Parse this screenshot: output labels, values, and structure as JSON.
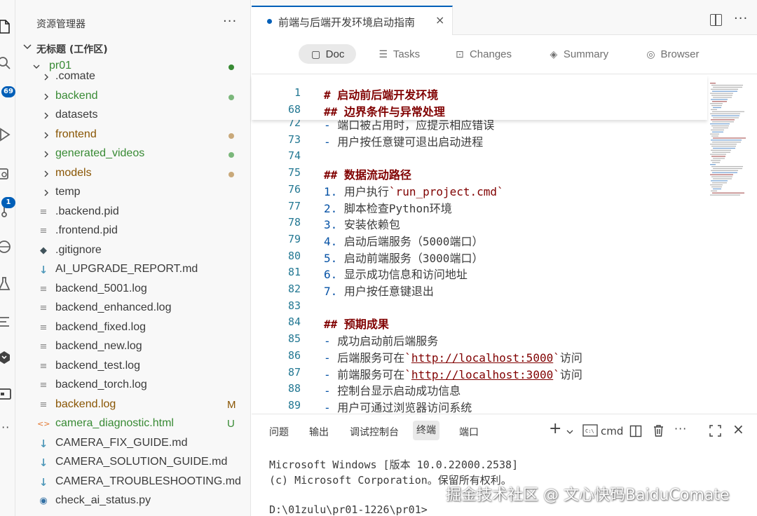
{
  "activity_bar": {
    "badges": {
      "search": "69",
      "source_control": "1"
    }
  },
  "explorer": {
    "title": "资源管理器",
    "more": "···",
    "workspace_label": "无标题 (工作区)",
    "items": [
      {
        "name": "pr01",
        "kind": "folder-open",
        "color": "#388a34",
        "dot": "#388a34"
      },
      {
        "name": ".comate",
        "kind": "folder",
        "color": "#3b3b3b"
      },
      {
        "name": "backend",
        "kind": "folder",
        "color": "#388a34",
        "dot": "#7bb77b"
      },
      {
        "name": "datasets",
        "kind": "folder",
        "color": "#3b3b3b"
      },
      {
        "name": "frontend",
        "kind": "folder",
        "color": "#895503",
        "dot": "#c9a97a"
      },
      {
        "name": "generated_videos",
        "kind": "folder",
        "color": "#388a34",
        "dot": "#7bb77b"
      },
      {
        "name": "models",
        "kind": "folder",
        "color": "#895503",
        "dot": "#c9a97a"
      },
      {
        "name": "temp",
        "kind": "folder",
        "color": "#3b3b3b"
      },
      {
        "name": ".backend.pid",
        "kind": "file",
        "color": "#3b3b3b"
      },
      {
        "name": ".frontend.pid",
        "kind": "file",
        "color": "#3b3b3b"
      },
      {
        "name": ".gitignore",
        "kind": "git",
        "color": "#3b3b3b"
      },
      {
        "name": "AI_UPGRADE_REPORT.md",
        "kind": "md",
        "color": "#3b3b3b"
      },
      {
        "name": "backend_5001.log",
        "kind": "file",
        "color": "#3b3b3b"
      },
      {
        "name": "backend_enhanced.log",
        "kind": "file",
        "color": "#3b3b3b"
      },
      {
        "name": "backend_fixed.log",
        "kind": "file",
        "color": "#3b3b3b"
      },
      {
        "name": "backend_new.log",
        "kind": "file",
        "color": "#3b3b3b"
      },
      {
        "name": "backend_test.log",
        "kind": "file",
        "color": "#3b3b3b"
      },
      {
        "name": "backend_torch.log",
        "kind": "file",
        "color": "#3b3b3b"
      },
      {
        "name": "backend.log",
        "kind": "file",
        "color": "#895503",
        "flag": "M"
      },
      {
        "name": "camera_diagnostic.html",
        "kind": "html",
        "color": "#388a34",
        "flag": "U"
      },
      {
        "name": "CAMERA_FIX_GUIDE.md",
        "kind": "md",
        "color": "#3b3b3b"
      },
      {
        "name": "CAMERA_SOLUTION_GUIDE.md",
        "kind": "md",
        "color": "#3b3b3b"
      },
      {
        "name": "CAMERA_TROUBLESHOOTING.md",
        "kind": "md",
        "color": "#3b3b3b"
      },
      {
        "name": "check_ai_status.py",
        "kind": "py",
        "color": "#3b3b3b"
      }
    ]
  },
  "editor": {
    "tab_label": "前端与后端开发环境启动指南",
    "tab_close": "×",
    "more": "···",
    "view_tabs": [
      {
        "label": "Doc",
        "icon": "doc-icon",
        "active": true
      },
      {
        "label": "Tasks",
        "icon": "tasks-icon"
      },
      {
        "label": "Changes",
        "icon": "changes-icon"
      },
      {
        "label": "Summary",
        "icon": "summary-icon"
      },
      {
        "label": "Browser",
        "icon": "browser-icon"
      }
    ],
    "sticky_lines": [
      {
        "num": "1",
        "parts": [
          {
            "t": "# 启动前后端开发环境",
            "c": "h"
          }
        ]
      },
      {
        "num": "68",
        "parts": [
          {
            "t": "## 边界条件与异常处理",
            "c": "h"
          }
        ]
      }
    ],
    "lines": [
      {
        "num": "72",
        "parts": [
          {
            "t": "- ",
            "c": "b"
          },
          {
            "t": "端口被占用时，应提示相应错误",
            "c": "tx"
          }
        ]
      },
      {
        "num": "73",
        "parts": [
          {
            "t": "- ",
            "c": "b"
          },
          {
            "t": "用户按任意键可退出启动进程",
            "c": "tx"
          }
        ]
      },
      {
        "num": "74",
        "parts": []
      },
      {
        "num": "75",
        "parts": [
          {
            "t": "## 数据流动路径",
            "c": "h"
          }
        ]
      },
      {
        "num": "76",
        "parts": [
          {
            "t": "1. ",
            "c": "b"
          },
          {
            "t": "用户执行",
            "c": "tx"
          },
          {
            "t": "`run_project.cmd`",
            "c": "cd"
          }
        ]
      },
      {
        "num": "77",
        "parts": [
          {
            "t": "2. ",
            "c": "b"
          },
          {
            "t": "脚本检查Python环境",
            "c": "tx"
          }
        ]
      },
      {
        "num": "78",
        "parts": [
          {
            "t": "3. ",
            "c": "b"
          },
          {
            "t": "安装依赖包",
            "c": "tx"
          }
        ]
      },
      {
        "num": "79",
        "parts": [
          {
            "t": "4. ",
            "c": "b"
          },
          {
            "t": "启动后端服务（5000端口）",
            "c": "tx"
          }
        ]
      },
      {
        "num": "80",
        "parts": [
          {
            "t": "5. ",
            "c": "b"
          },
          {
            "t": "启动前端服务（3000端口）",
            "c": "tx"
          }
        ]
      },
      {
        "num": "81",
        "parts": [
          {
            "t": "6. ",
            "c": "b"
          },
          {
            "t": "显示成功信息和访问地址",
            "c": "tx"
          }
        ]
      },
      {
        "num": "82",
        "parts": [
          {
            "t": "7. ",
            "c": "b"
          },
          {
            "t": "用户按任意键退出",
            "c": "tx"
          }
        ]
      },
      {
        "num": "83",
        "parts": []
      },
      {
        "num": "84",
        "parts": [
          {
            "t": "## 预期成果",
            "c": "h"
          }
        ]
      },
      {
        "num": "85",
        "parts": [
          {
            "t": "- ",
            "c": "b"
          },
          {
            "t": "成功启动前后端服务",
            "c": "tx"
          }
        ]
      },
      {
        "num": "86",
        "parts": [
          {
            "t": "- ",
            "c": "b"
          },
          {
            "t": "后端服务可在",
            "c": "tx"
          },
          {
            "t": "`",
            "c": "cd"
          },
          {
            "t": "http://localhost:5000",
            "c": "ul"
          },
          {
            "t": "`",
            "c": "cd"
          },
          {
            "t": "访问",
            "c": "tx"
          }
        ]
      },
      {
        "num": "87",
        "parts": [
          {
            "t": "- ",
            "c": "b"
          },
          {
            "t": "前端服务可在",
            "c": "tx"
          },
          {
            "t": "`",
            "c": "cd"
          },
          {
            "t": "http://localhost:3000",
            "c": "ul"
          },
          {
            "t": "`",
            "c": "cd"
          },
          {
            "t": "访问",
            "c": "tx"
          }
        ]
      },
      {
        "num": "88",
        "parts": [
          {
            "t": "- ",
            "c": "b"
          },
          {
            "t": "控制台显示启动成功信息",
            "c": "tx"
          }
        ]
      },
      {
        "num": "89",
        "parts": [
          {
            "t": "- ",
            "c": "b"
          },
          {
            "t": "用户可通过浏览器访问系统",
            "c": "tx"
          }
        ]
      }
    ]
  },
  "panel": {
    "tabs": [
      "问题",
      "输出",
      "调试控制台",
      "终端",
      "端口"
    ],
    "active_tab": "终端",
    "shell_label": "cmd",
    "add": "+",
    "more": "···",
    "close": "×",
    "terminal_lines": [
      "Microsoft Windows [版本 10.0.22000.2538]",
      "(c) Microsoft Corporation。保留所有权利。",
      "",
      "D:\\01zulu\\pr01-1226\\pr01>"
    ]
  },
  "watermark": "掘金技术社区 @ 文心快码BaiduComate"
}
